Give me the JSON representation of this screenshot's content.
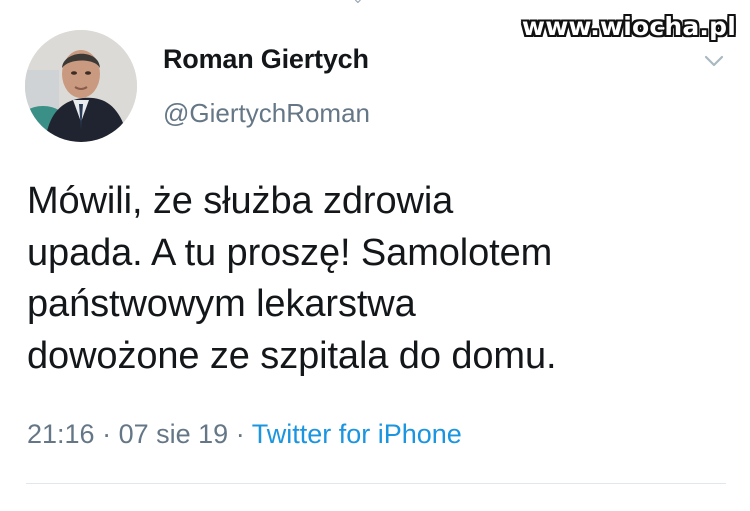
{
  "watermark": "www.wiocha.pl",
  "tweet": {
    "author": {
      "display_name": "Roman Giertych",
      "handle": "@GiertychRoman",
      "avatar": "profile-photo"
    },
    "text_lines": [
      "Mówili, że służba zdrowia",
      "upada. A tu proszę! Samolotem",
      "państwowym lekarstwa",
      "dowożone ze szpitala do domu."
    ],
    "time": "21:16",
    "date": "07 sie 19",
    "separator": "·",
    "source": "Twitter for iPhone",
    "menu_icon": "chevron-down-icon"
  },
  "colors": {
    "text_primary": "#14171a",
    "text_secondary": "#657786",
    "link": "#1b95e0",
    "divider": "#e1e8ed"
  }
}
